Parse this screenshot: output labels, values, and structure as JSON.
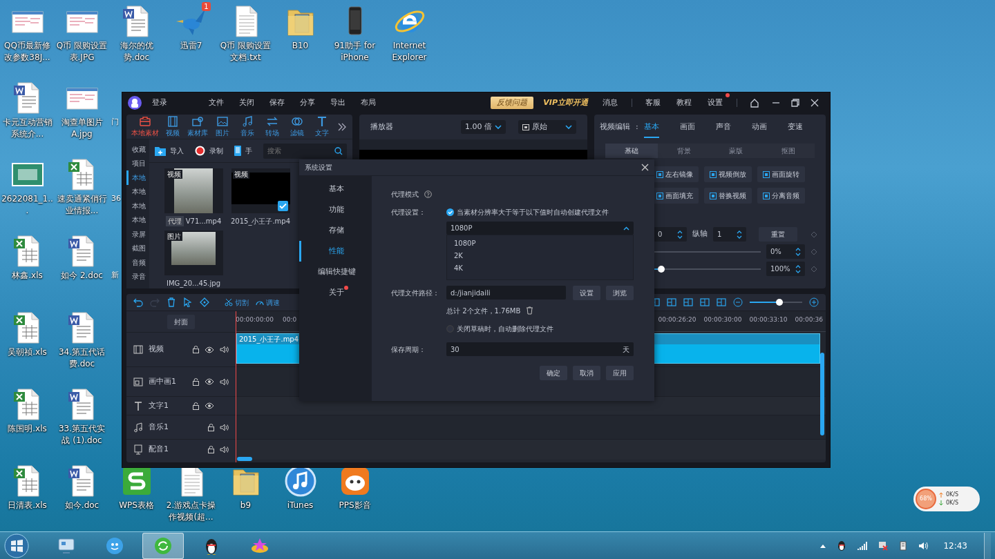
{
  "desktop": {
    "top_row": [
      {
        "label": "QQ币最新修改参数38J...",
        "kind": "screenshot"
      },
      {
        "label": "Q币 限购设置表.JPG",
        "kind": "screenshot"
      },
      {
        "label": "海尔的优势.doc",
        "kind": "word"
      },
      {
        "label": "迅雷7",
        "kind": "bird",
        "badge": "1"
      },
      {
        "label": "Q币 限购设置文档.txt",
        "kind": "text"
      },
      {
        "label": "B10",
        "kind": "folder"
      },
      {
        "label": "91助手 for iPhone",
        "kind": "phone"
      },
      {
        "label": "Internet Explorer",
        "kind": "ie"
      }
    ],
    "column_1": [
      {
        "label": "卡元互动营销系统介...",
        "kind": "word"
      },
      {
        "label": "2622081_1...",
        "kind": "photo"
      },
      {
        "label": "林鑫.xls",
        "kind": "excel"
      },
      {
        "label": "吴朝祯.xls",
        "kind": "excel"
      },
      {
        "label": "陈国明.xls",
        "kind": "excel"
      },
      {
        "label": "日清表.xls",
        "kind": "excel"
      }
    ],
    "column_2": [
      {
        "label": "淘查单图片A.jpg",
        "kind": "screenshot"
      },
      {
        "label": "速卖通紧俏行业情报...",
        "kind": "excel"
      },
      {
        "label": "如今 2.doc",
        "kind": "word"
      },
      {
        "label": "34.第五代话费.doc",
        "kind": "word"
      },
      {
        "label": "33.第五代实战 (1).doc",
        "kind": "word"
      },
      {
        "label": "如今.doc",
        "kind": "word"
      }
    ],
    "partial_labels": [
      "门",
      "36",
      "新"
    ],
    "bottom_row": [
      {
        "label": "WPS表格",
        "kind": "wps"
      },
      {
        "label": "2.游戏点卡操作视频(超...",
        "kind": "text"
      },
      {
        "label": "b9",
        "kind": "folder"
      },
      {
        "label": "iTunes",
        "kind": "itunes"
      },
      {
        "label": "PPS影音",
        "kind": "pps"
      }
    ]
  },
  "app": {
    "login": "登录",
    "menu": [
      "文件",
      "关闭",
      "保存",
      "分享",
      "导出",
      "布局"
    ],
    "feedback": "反馈问题",
    "vip": "VIP立即开通",
    "links": [
      {
        "label": "消息",
        "dot": false
      },
      {
        "label": "客服",
        "dot": false
      },
      {
        "label": "教程",
        "dot": false
      },
      {
        "label": "设置",
        "dot": true
      }
    ],
    "media": {
      "tabs": [
        {
          "label": "本地素材",
          "selected": true
        },
        {
          "label": "视频",
          "selected": false
        },
        {
          "label": "素材库",
          "selected": false
        },
        {
          "label": "图片",
          "selected": false
        },
        {
          "label": "音乐",
          "selected": false
        },
        {
          "label": "转场",
          "selected": false
        },
        {
          "label": "滤镜",
          "selected": false
        },
        {
          "label": "文字",
          "selected": false
        }
      ],
      "sidebar": [
        {
          "label": "收藏",
          "selected": false
        },
        {
          "label": "项目",
          "selected": false
        },
        {
          "label": "本地",
          "selected": true
        },
        {
          "label": "本地",
          "selected": false
        },
        {
          "label": "本地",
          "selected": false
        },
        {
          "label": "本地",
          "selected": false
        },
        {
          "label": "录屏",
          "selected": false
        },
        {
          "label": "截图",
          "selected": false
        },
        {
          "label": "音频",
          "selected": false
        },
        {
          "label": "录音",
          "selected": false
        }
      ],
      "import": "导入",
      "record": "录制",
      "phone": "手",
      "search_placeholder": "搜索",
      "items": [
        {
          "tag": "视频",
          "kind": "photo",
          "proxy": "代理",
          "name": "V71...mp4",
          "checked": false
        },
        {
          "tag": "视频",
          "kind": "blank",
          "name": "2015_小王子.mp4",
          "checked": true
        },
        {
          "tag": "图片",
          "kind": "photo",
          "name": "IMG_20...45.jpg",
          "checked": false
        }
      ]
    },
    "player": {
      "title": "播放器",
      "speed": "1.00 倍",
      "ratio": "原始"
    },
    "properties": {
      "label": "视频编辑",
      "separator": ":",
      "tabs": [
        {
          "label": "基本",
          "selected": true
        },
        {
          "label": "画面",
          "selected": false
        },
        {
          "label": "声音",
          "selected": false
        },
        {
          "label": "动画",
          "selected": false
        },
        {
          "label": "变速",
          "selected": false
        }
      ],
      "subtabs": [
        {
          "label": "基础",
          "selected": true
        },
        {
          "label": "背景",
          "selected": false
        },
        {
          "label": "蒙版",
          "selected": false
        },
        {
          "label": "抠图",
          "selected": false
        }
      ],
      "buttons": [
        "左右镜像",
        "视频倒放",
        "画面旋转",
        "画面填充",
        "替换视频",
        "分离音频"
      ],
      "x_value": "0",
      "y_label": "纵轴",
      "y_value": "1",
      "reset": "重置",
      "opacity": "0%",
      "opacity_slider": {
        "level": 0
      },
      "scale": "100%",
      "scale_slider": {
        "level": 0.35
      }
    },
    "timeline": {
      "cut": "切割",
      "speed": "调速",
      "zoom": {
        "level": 0.56
      },
      "cover": "封面",
      "tracks": [
        {
          "label": "视频",
          "kind": "video",
          "eye": true,
          "audio": true
        },
        {
          "label": "画中画1",
          "kind": "pip",
          "eye": true,
          "audio": true
        },
        {
          "label": "文字1",
          "kind": "text",
          "eye": true,
          "audio": false
        },
        {
          "label": "音乐1",
          "kind": "music",
          "eye": false,
          "audio": true
        },
        {
          "label": "配音1",
          "kind": "voice",
          "eye": false,
          "audio": true
        }
      ],
      "ruler": [
        "00:00:00:00",
        "00:0",
        "00:00:26:20",
        "00:00:30:00",
        "00:00:33:10",
        "00:00:36"
      ],
      "clip": "2015_小王子.mp4"
    },
    "dialog": {
      "title": "系统设置",
      "nav": [
        {
          "label": "基本",
          "selected": false,
          "dot": false
        },
        {
          "label": "功能",
          "selected": false,
          "dot": false
        },
        {
          "label": "存储",
          "selected": false,
          "dot": false
        },
        {
          "label": "性能",
          "selected": true,
          "dot": false
        },
        {
          "label": "编辑快捷键",
          "selected": false,
          "dot": false
        },
        {
          "label": "关于",
          "selected": false,
          "dot": true
        }
      ],
      "proxy_mode": "代理模式",
      "proxy_setting": "代理设置：",
      "auto_proxy": {
        "label": "当素材分辨率大于等于以下值时自动创建代理文件",
        "checked": true
      },
      "resolution": {
        "value": "1080P",
        "expanded": true,
        "options": [
          "1080P",
          "2K",
          "4K"
        ]
      },
      "path_label": "代理文件路径：",
      "path": "d:/jianjidaili",
      "set": "设置",
      "browse": "浏览",
      "total": "总计 2个文件，1.76MB",
      "auto_delete": {
        "label": "关闭草稿时，自动删除代理文件",
        "checked": false
      },
      "period_label": "保存周期：",
      "period": "30",
      "unit": "天",
      "buttons": [
        "确定",
        "取消",
        "应用"
      ]
    }
  },
  "speed_widget": {
    "percent": "68%",
    "up": "0K/S",
    "down": "0K/S"
  },
  "taskbar": {
    "pinned": [
      {
        "kind": "control-panel",
        "selected": false
      },
      {
        "kind": "bird",
        "selected": false
      },
      {
        "kind": "ie",
        "selected": true
      },
      {
        "kind": "penguin",
        "selected": false
      },
      {
        "kind": "star",
        "selected": false
      }
    ],
    "clock": "12:43"
  }
}
